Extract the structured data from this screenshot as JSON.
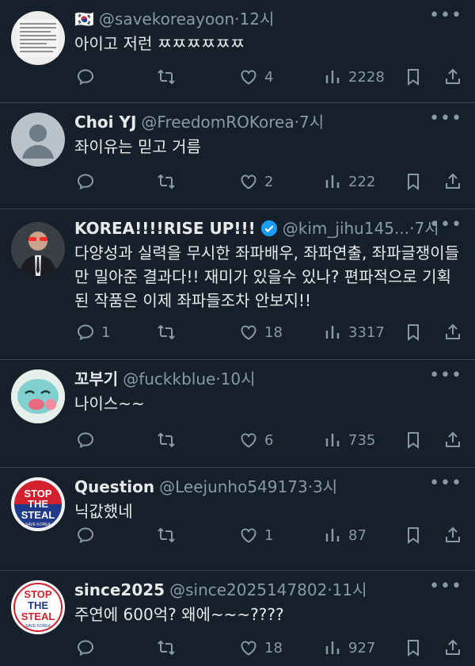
{
  "posts": [
    {
      "name": "🇰🇷",
      "handle": "@savekoreayoon",
      "time": "12시",
      "text": "아이고 저런 ㅉㅉㅉㅉㅉㅉ",
      "replies": "",
      "retweets": "",
      "likes": "4",
      "views": "2228",
      "verified": false
    },
    {
      "name": "Choi YJ",
      "handle": "@FreedomROKorea",
      "time": "7시",
      "text": "좌이유는 믿고 거름",
      "replies": "",
      "retweets": "",
      "likes": "2",
      "views": "222",
      "verified": false
    },
    {
      "name": "KOREA!!!!RISE UP!!!",
      "handle": "@kim_jihu145...",
      "time": "7시",
      "text": "다양성과 실력을 무시한 좌파배우, 좌파연출, 좌파글쟁이들만 밀아준 결과다!! 재미가 있을수 있나? 편파적으로 기획된 작품은 이제 좌파들조차 안보지!!",
      "replies": "1",
      "retweets": "",
      "likes": "18",
      "views": "3317",
      "verified": true
    },
    {
      "name": "꼬부기",
      "handle": "@fuckkblue",
      "time": "10시",
      "text": "나이스~~",
      "replies": "",
      "retweets": "",
      "likes": "6",
      "views": "735",
      "verified": false
    },
    {
      "name": "Question",
      "handle": "@Leejunho549173",
      "time": "3시",
      "text": "닉값했네",
      "replies": "",
      "retweets": "",
      "likes": "1",
      "views": "87",
      "verified": false
    },
    {
      "name": "since2025",
      "handle": "@since2025147802",
      "time": "11시",
      "text": "주연에 600억? 왜에~~~????",
      "replies": "",
      "retweets": "",
      "likes": "18",
      "views": "927",
      "verified": false
    }
  ],
  "avatar_text": {
    "stop": "STOP",
    "the": "THE",
    "steal": "STEAL",
    "save": "SAVE KOREA"
  },
  "colors": {
    "bg": "#15202b",
    "muted": "#8b98a5",
    "verified": "#1d9bf0",
    "divider": "#38444d"
  }
}
